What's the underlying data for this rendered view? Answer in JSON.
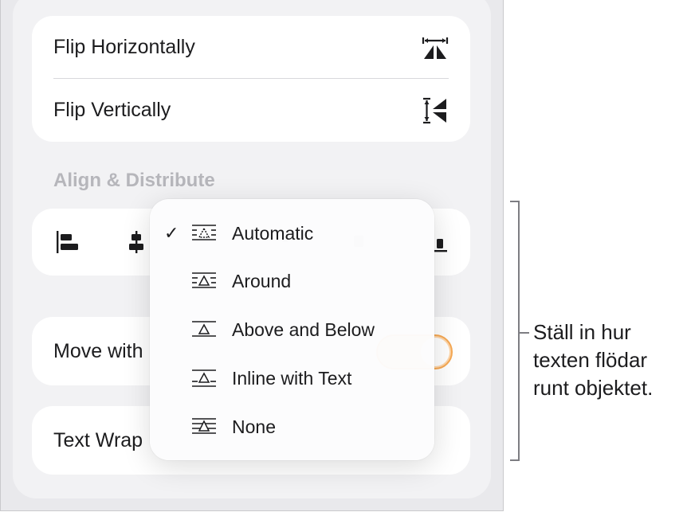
{
  "flip": {
    "horizontal_label": "Flip Horizontally",
    "vertical_label": "Flip Vertically"
  },
  "align_section": {
    "header": "Align & Distribute",
    "icons": [
      "align-left-icon",
      "align-center-icon",
      "align-right-icon",
      "align-top-icon",
      "align-middle-icon",
      "align-bottom-icon"
    ]
  },
  "move_with_text": {
    "label_visible": "Move with",
    "toggle_on": true,
    "accent_color": "#f59a36"
  },
  "text_wrap": {
    "label_visible": "Text Wrap"
  },
  "wrap_menu": {
    "items": [
      {
        "label": "Automatic",
        "checked": true,
        "icon": "wrap-automatic-icon"
      },
      {
        "label": "Around",
        "checked": false,
        "icon": "wrap-around-icon"
      },
      {
        "label": "Above and Below",
        "checked": false,
        "icon": "wrap-above-below-icon"
      },
      {
        "label": "Inline with Text",
        "checked": false,
        "icon": "wrap-inline-icon"
      },
      {
        "label": "None",
        "checked": false,
        "icon": "wrap-none-icon"
      }
    ],
    "check_glyph": "✓"
  },
  "callout": {
    "line1": "Ställ in hur",
    "line2": "texten flödar",
    "line3": "runt objektet."
  }
}
